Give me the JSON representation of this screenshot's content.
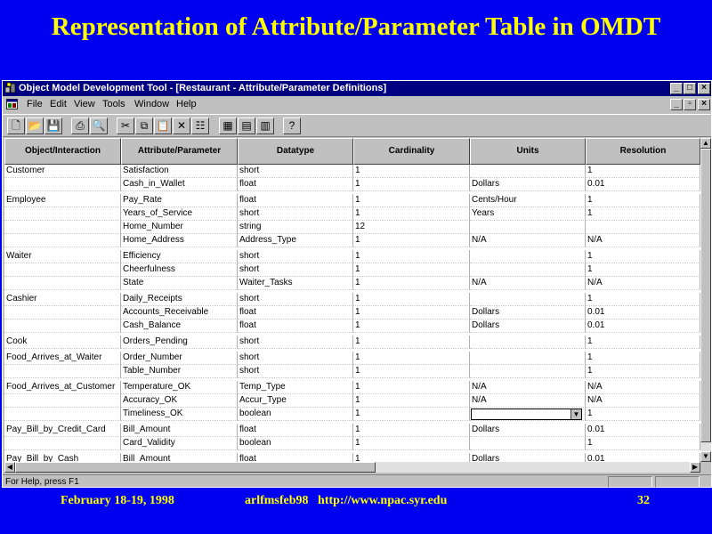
{
  "slide": {
    "title": "Representation of Attribute/Parameter Table in OMDT",
    "footer_date": "February 18-19, 1998",
    "footer_source": "arlfmsfeb98   http://www.npac.syr.edu",
    "footer_page": "32"
  },
  "window": {
    "title": "Object Model Development Tool - [Restaurant - Attribute/Parameter Definitions]",
    "menu": [
      "File",
      "Edit",
      "View",
      "Tools",
      "Window",
      "Help"
    ],
    "toolbar_icons": [
      "new-icon",
      "open-icon",
      "save-icon",
      "print-icon",
      "print-preview-icon",
      "cut-icon",
      "copy-icon",
      "paste-icon",
      "delete-icon",
      "properties-icon",
      "table-icon",
      "import-icon",
      "export-icon",
      "help-icon"
    ],
    "status_text": "For Help, press F1"
  },
  "table": {
    "columns": [
      "Object/Interaction",
      "Attribute/Parameter",
      "Datatype",
      "Cardinality",
      "Units",
      "Resolution"
    ],
    "rows": [
      [
        "Customer",
        "Satisfaction",
        "short",
        "1",
        "",
        "1"
      ],
      [
        "",
        "Cash_in_Wallet",
        "float",
        "1",
        "Dollars",
        "0.01"
      ],
      [
        "Employee",
        "Pay_Rate",
        "float",
        "1",
        "Cents/Hour",
        "1"
      ],
      [
        "",
        "Years_of_Service",
        "short",
        "1",
        "Years",
        "1"
      ],
      [
        "",
        "Home_Number",
        "string",
        "12",
        "",
        ""
      ],
      [
        "",
        "Home_Address",
        "Address_Type",
        "1",
        "N/A",
        "N/A"
      ],
      [
        "Waiter",
        "Efficiency",
        "short",
        "1",
        "",
        "1"
      ],
      [
        "",
        "Cheerfulness",
        "short",
        "1",
        "",
        "1"
      ],
      [
        "",
        "State",
        "Waiter_Tasks",
        "1",
        "N/A",
        "N/A"
      ],
      [
        "Cashier",
        "Daily_Receipts",
        "short",
        "1",
        "",
        "1"
      ],
      [
        "",
        "Accounts_Receivable",
        "float",
        "1",
        "Dollars",
        "0.01"
      ],
      [
        "",
        "Cash_Balance",
        "float",
        "1",
        "Dollars",
        "0.01"
      ],
      [
        "Cook",
        "Orders_Pending",
        "short",
        "1",
        "",
        "1"
      ],
      [
        "Food_Arrives_at_Waiter",
        "Order_Number",
        "short",
        "1",
        "",
        "1"
      ],
      [
        "",
        "Table_Number",
        "short",
        "1",
        "",
        "1"
      ],
      [
        "Food_Arrives_at_Customer",
        "Temperature_OK",
        "Temp_Type",
        "1",
        "N/A",
        "N/A"
      ],
      [
        "",
        "Accuracy_OK",
        "Accur_Type",
        "1",
        "N/A",
        "N/A"
      ],
      [
        "",
        "Timeliness_OK",
        "boolean",
        "1",
        "",
        "1"
      ],
      [
        "Pay_Bill_by_Credit_Card",
        "Bill_Amount",
        "float",
        "1",
        "Dollars",
        "0.01"
      ],
      [
        "",
        "Card_Validity",
        "boolean",
        "1",
        "",
        "1"
      ],
      [
        "Pay_Bill_by_Cash",
        "Bill_Amount",
        "float",
        "1",
        "Dollars",
        "0.01"
      ]
    ]
  }
}
